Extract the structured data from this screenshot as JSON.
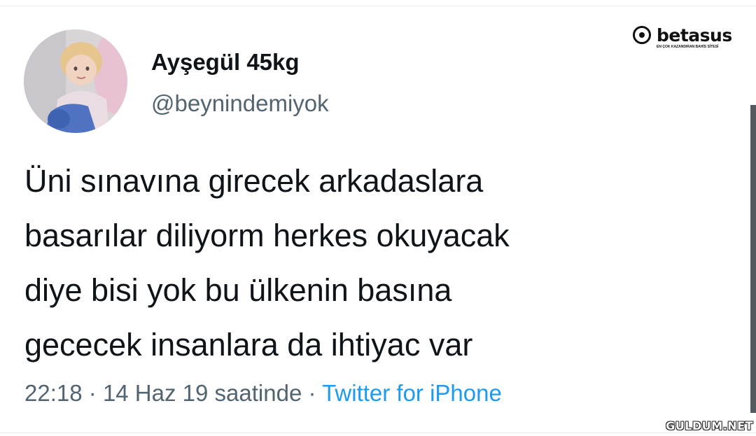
{
  "tweet": {
    "display_name": "Ayşegül 45kg",
    "handle": "@beynindemiyok",
    "text_lines": [
      "Üni sınavına girecek arkadaslara",
      "basarılar diliyorm herkes okuyacak",
      "diye bisi yok bu ülkenin basına",
      "gececek insanlara da ihtiyac var"
    ],
    "time": "22:18",
    "separator": "·",
    "date": "14 Haz 19 saatinde",
    "source": "Twitter for iPhone"
  },
  "watermarks": {
    "betasus_word": "betasus",
    "betasus_tagline": "EN ÇOK KAZANDIRAN BAHİS SİTESİ",
    "guldum": "GULDUM.NET"
  },
  "colors": {
    "text_primary": "#0f1419",
    "text_secondary": "#536471",
    "link": "#1d9bf0"
  },
  "icons": {
    "avatar": "profile-photo-child",
    "betasus_logo": "target-circle-logo"
  }
}
